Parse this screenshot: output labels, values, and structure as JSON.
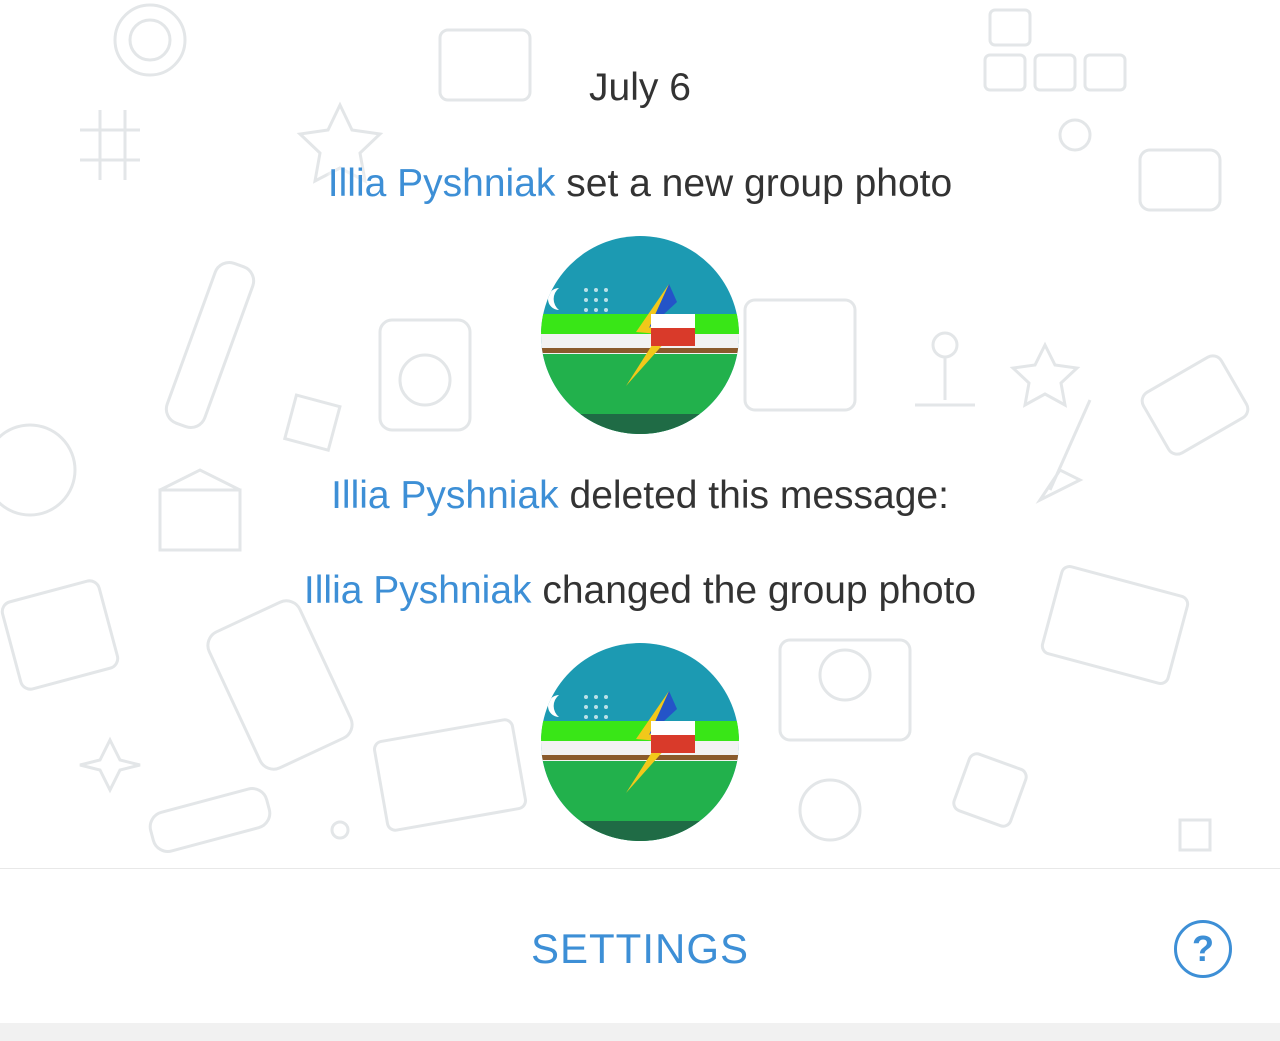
{
  "chat": {
    "date": "July 6",
    "events": [
      {
        "actor": "Illia Pyshniak",
        "action": "set a new group photo"
      },
      {
        "actor": "Illia Pyshniak",
        "action": "deleted this message:"
      },
      {
        "actor": "Illia Pyshniak",
        "action": "changed the group photo"
      }
    ]
  },
  "bottom_bar": {
    "settings_label": "SETTINGS",
    "help_icon": "question-circle-icon",
    "help_glyph": "?"
  },
  "colors": {
    "accent": "#3d8fd6",
    "text": "#333333",
    "photo_sky": "#1c9ab2",
    "photo_grass": "#22b14c",
    "photo_band": "#39e617",
    "photo_bolt": "#f2c81a",
    "photo_red": "#d93a2a"
  }
}
